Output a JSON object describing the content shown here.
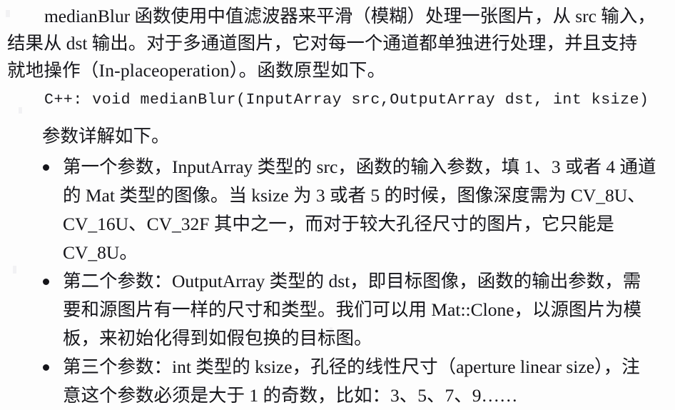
{
  "page": {
    "background_color": "#fdfdfd",
    "text_color": "#17171c",
    "type": "scanned-book-page"
  },
  "intro_paragraph": {
    "line1": "medianBlur 函数使用中值滤波器来平滑（模糊）处理一张图片，从 src 输入，",
    "line2": "结果从 dst 输出。对于多通道图片，它对每一个通道都单独进行处理，并且支持",
    "line3": "就地操作（In-placeoperation）。函数原型如下。"
  },
  "code_prototype": {
    "text": "C++: void medianBlur(InputArray src,OutputArray dst, int ksize)",
    "language": "C++"
  },
  "lead_in": {
    "text": "参数详解如下。"
  },
  "parameters": {
    "bullet_glyph": "•",
    "items": [
      {
        "name": "parameter-src",
        "lines": [
          "第一个参数，InputArray 类型的 src，函数的输入参数，填 1、3 或者 4 通道",
          "的 Mat 类型的图像。当 ksize 为 3 或者 5 的时候，图像深度需为 CV_8U、",
          "CV_16U、CV_32F 其中之一，而对于较大孔径尺寸的图片，它只能是",
          "CV_8U。"
        ]
      },
      {
        "name": "parameter-dst",
        "lines": [
          "第二个参数：OutputArray 类型的 dst，即目标图像，函数的输出参数，需",
          "要和源图片有一样的尺寸和类型。我们可以用 Mat::Clone，以源图片为模",
          "板，来初始化得到如假包换的目标图。"
        ]
      },
      {
        "name": "parameter-ksize",
        "lines": [
          "第三个参数：int 类型的 ksize，孔径的线性尺寸（aperture linear size），注",
          "意这个参数必须是大于 1 的奇数，比如：3、5、7、9……"
        ]
      }
    ]
  }
}
